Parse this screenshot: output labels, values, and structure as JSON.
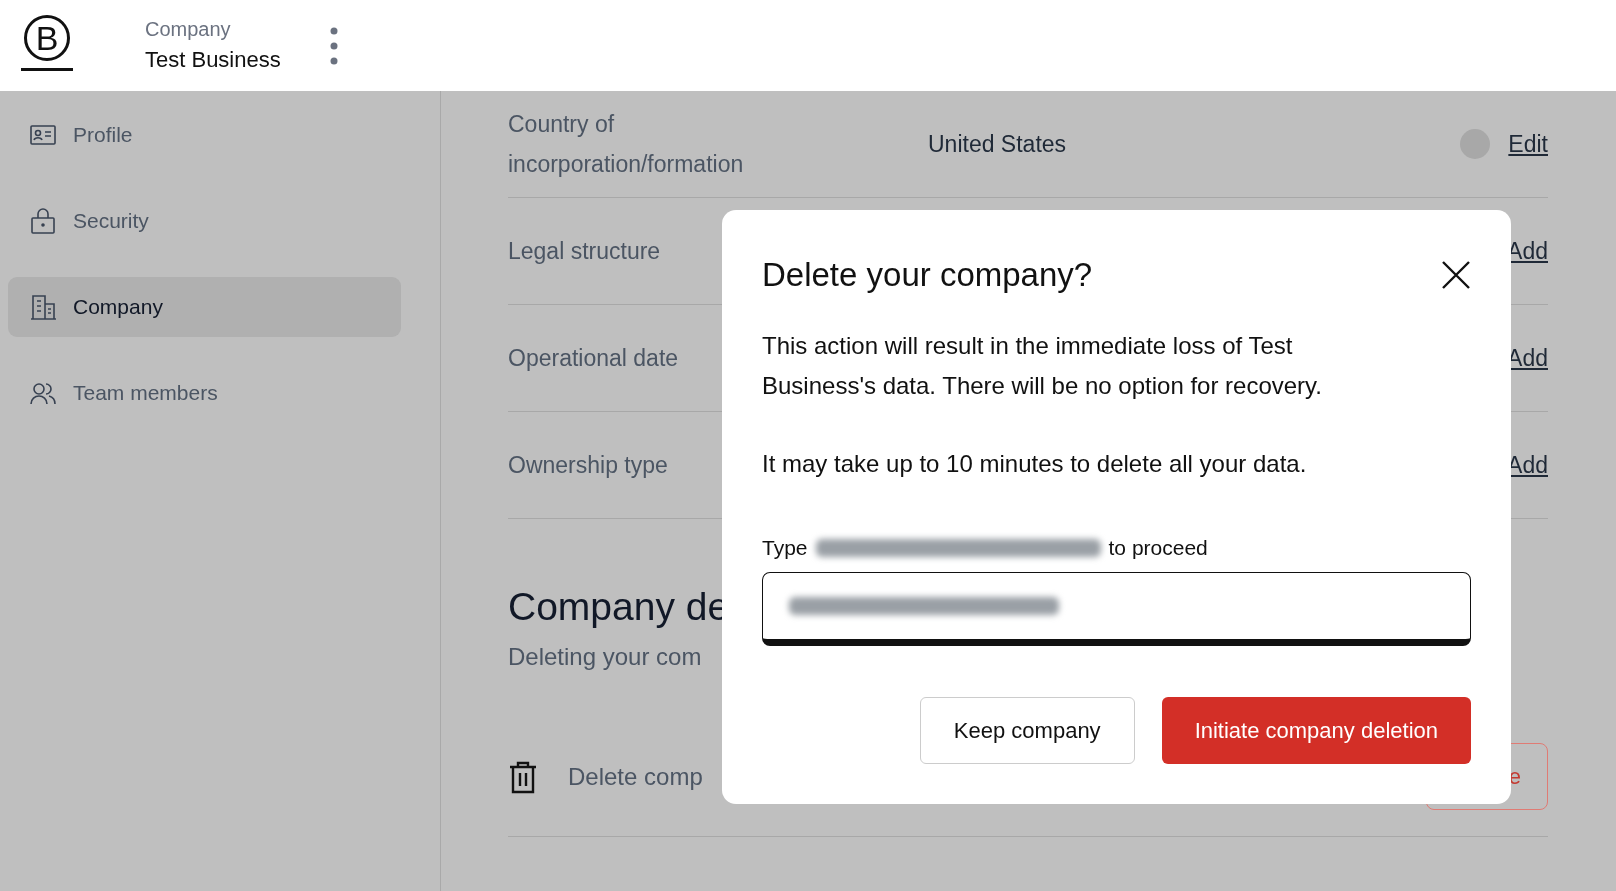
{
  "header": {
    "logo_letter": "B",
    "section": "Company",
    "name": "Test Business"
  },
  "sidebar": {
    "items": [
      {
        "label": "Profile",
        "kind": "profile",
        "selected": false
      },
      {
        "label": "Security",
        "kind": "security",
        "selected": false
      },
      {
        "label": "Company",
        "kind": "company",
        "selected": true
      },
      {
        "label": "Team members",
        "kind": "team",
        "selected": false
      }
    ]
  },
  "content": {
    "rows": [
      {
        "label": "Country of incorporation/formation",
        "value": "United States",
        "info": true,
        "action": "Edit"
      },
      {
        "label": "Legal structure",
        "action": "Add"
      },
      {
        "label": "Operational date",
        "action": "Add"
      },
      {
        "label": "Ownership type",
        "action": "Add"
      }
    ],
    "section_title": "Company de",
    "section_text": "Deleting your com",
    "delete_row": {
      "label": "Delete comp",
      "button": "e"
    }
  },
  "dialog": {
    "title": "Delete your company?",
    "paragraphs": [
      "This action will result in the immediate loss of Test Business's data. There will be no option for recovery.",
      "It may take up to 10 minutes to delete all your data."
    ],
    "prompt_before": "Type",
    "prompt_after": "to proceed",
    "buttons": [
      {
        "label": "Keep company",
        "kind": "secondary"
      },
      {
        "label": "Initiate company deletion",
        "kind": "danger"
      }
    ]
  }
}
